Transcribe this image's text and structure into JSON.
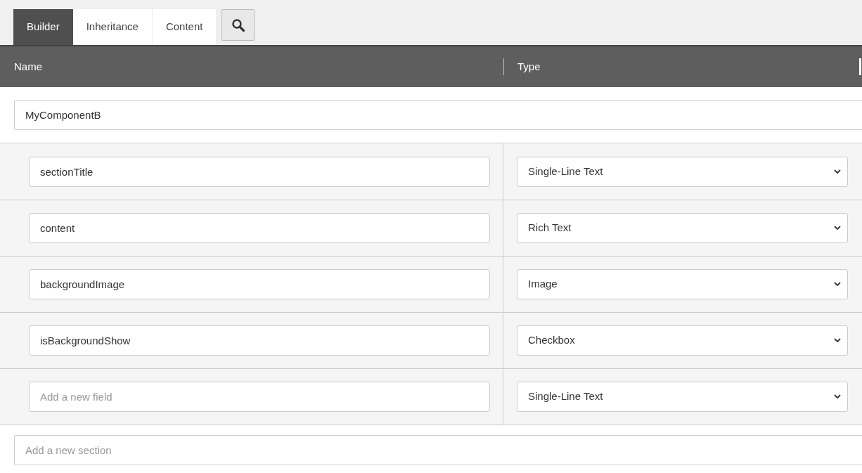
{
  "tabs": [
    {
      "label": "Builder",
      "selected": true
    },
    {
      "label": "Inheritance",
      "selected": false
    },
    {
      "label": "Content",
      "selected": false
    }
  ],
  "table": {
    "columns": [
      "Name",
      "Type"
    ],
    "section": {
      "name": "MyComponentB"
    },
    "fields": [
      {
        "name": "sectionTitle",
        "type": "Single-Line Text"
      },
      {
        "name": "content",
        "type": "Rich Text"
      },
      {
        "name": "backgroundImage",
        "type": "Image"
      },
      {
        "name": "isBackgroundShow",
        "type": "Checkbox"
      }
    ],
    "new_field": {
      "placeholder": "Add a new field",
      "type": "Single-Line Text"
    },
    "new_section": {
      "placeholder": "Add a new section"
    }
  }
}
